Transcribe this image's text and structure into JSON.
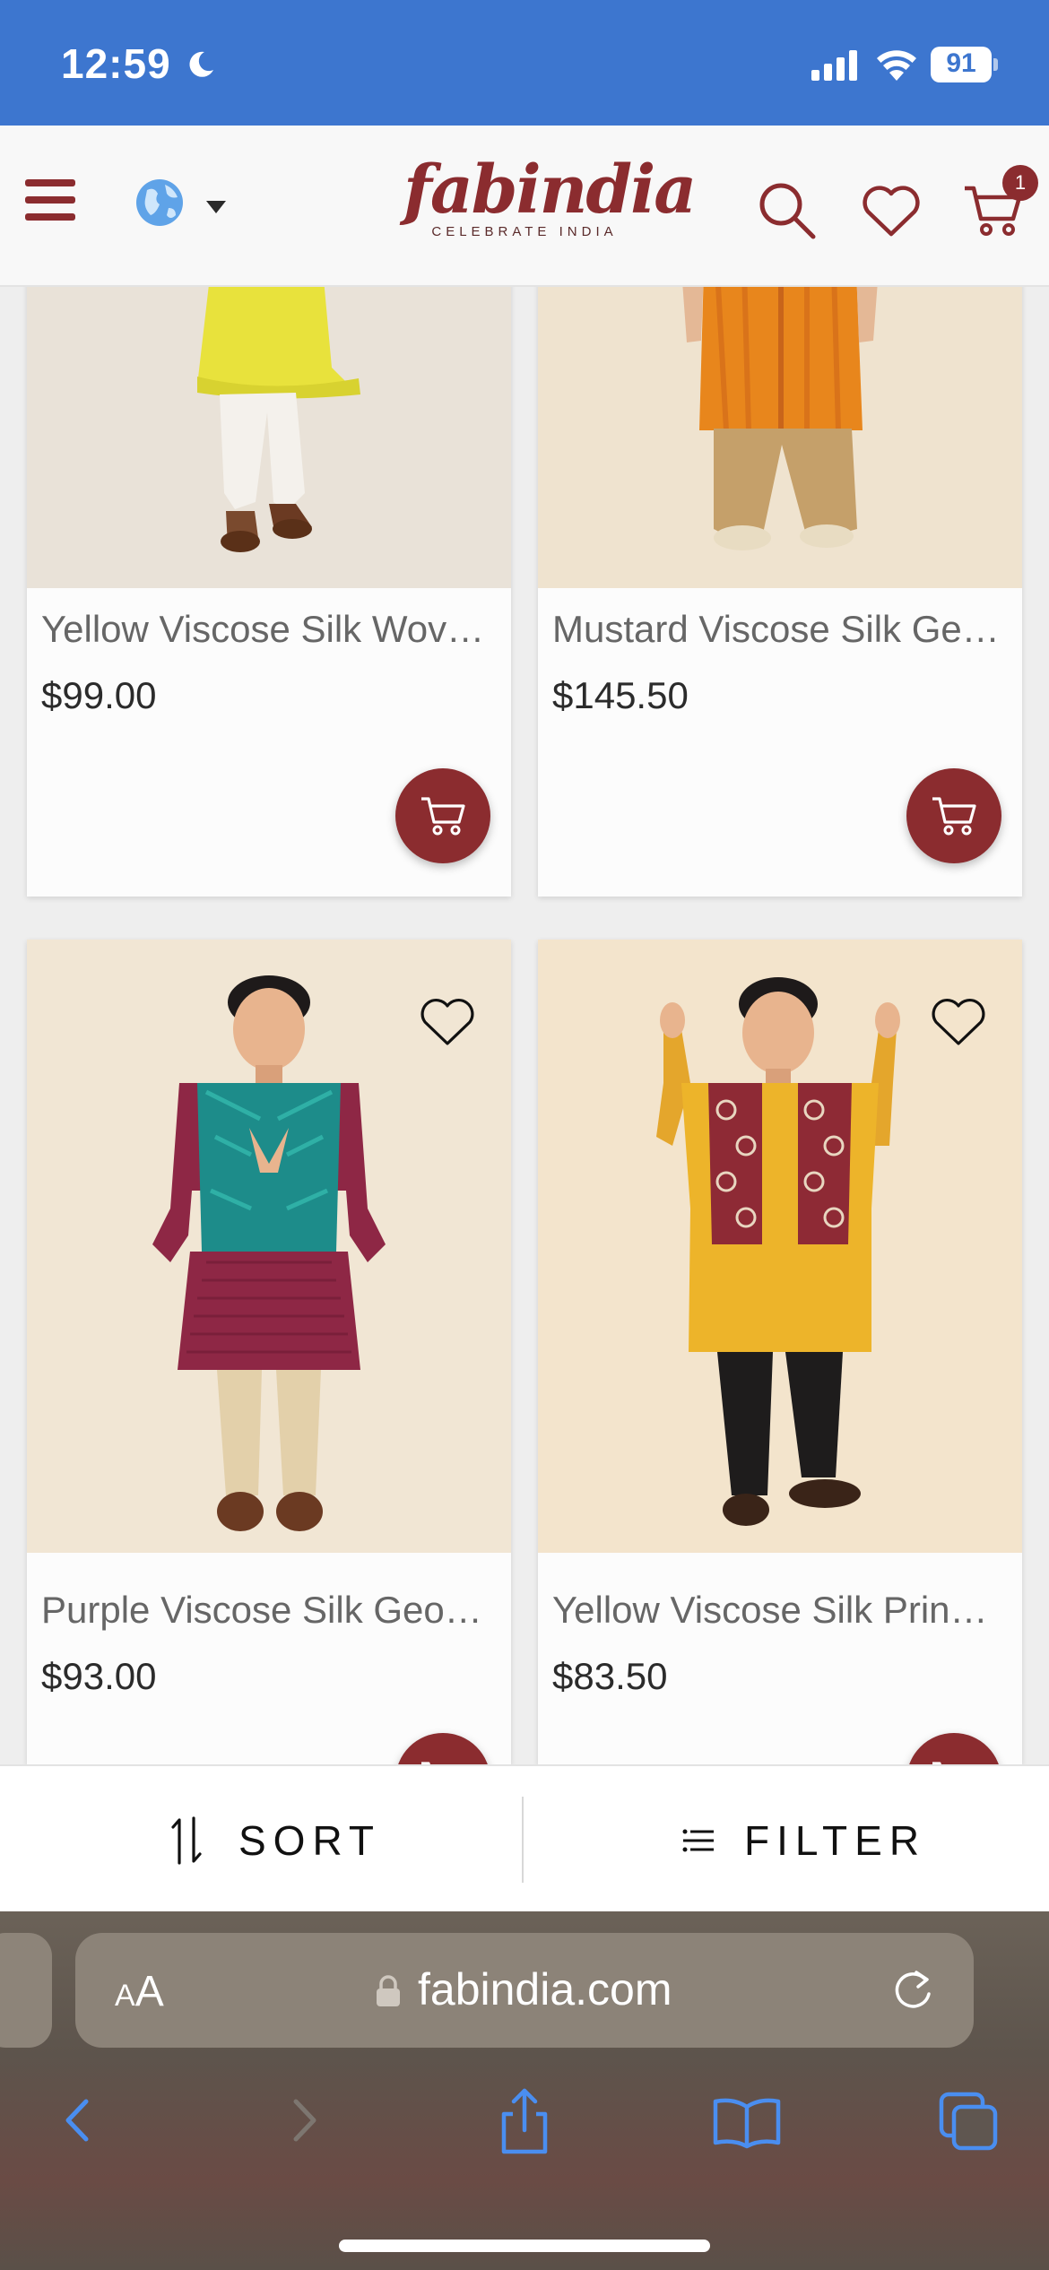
{
  "status_bar": {
    "time": "12:59",
    "battery": "91"
  },
  "header": {
    "brand": "fabindia",
    "tagline": "CELEBRATE INDIA",
    "cart_count": "1"
  },
  "products": [
    {
      "name": "Yellow Viscose Silk Wov…",
      "price": "$99.00"
    },
    {
      "name": "Mustard Viscose Silk Ge…",
      "price": "$145.50"
    },
    {
      "name": "Purple Viscose Silk Geo…",
      "price": "$93.00"
    },
    {
      "name": "Yellow Viscose Silk Prin…",
      "price": "$83.50"
    }
  ],
  "bottom_bar": {
    "sort_label": "SORT",
    "filter_label": "FILTER"
  },
  "browser": {
    "text_size_small": "A",
    "text_size_big": "A",
    "url": "fabindia.com"
  },
  "colors": {
    "status_bar": "#3d76cf",
    "brand": "#8b2c2f",
    "ios_blue": "#4a8ef0"
  }
}
